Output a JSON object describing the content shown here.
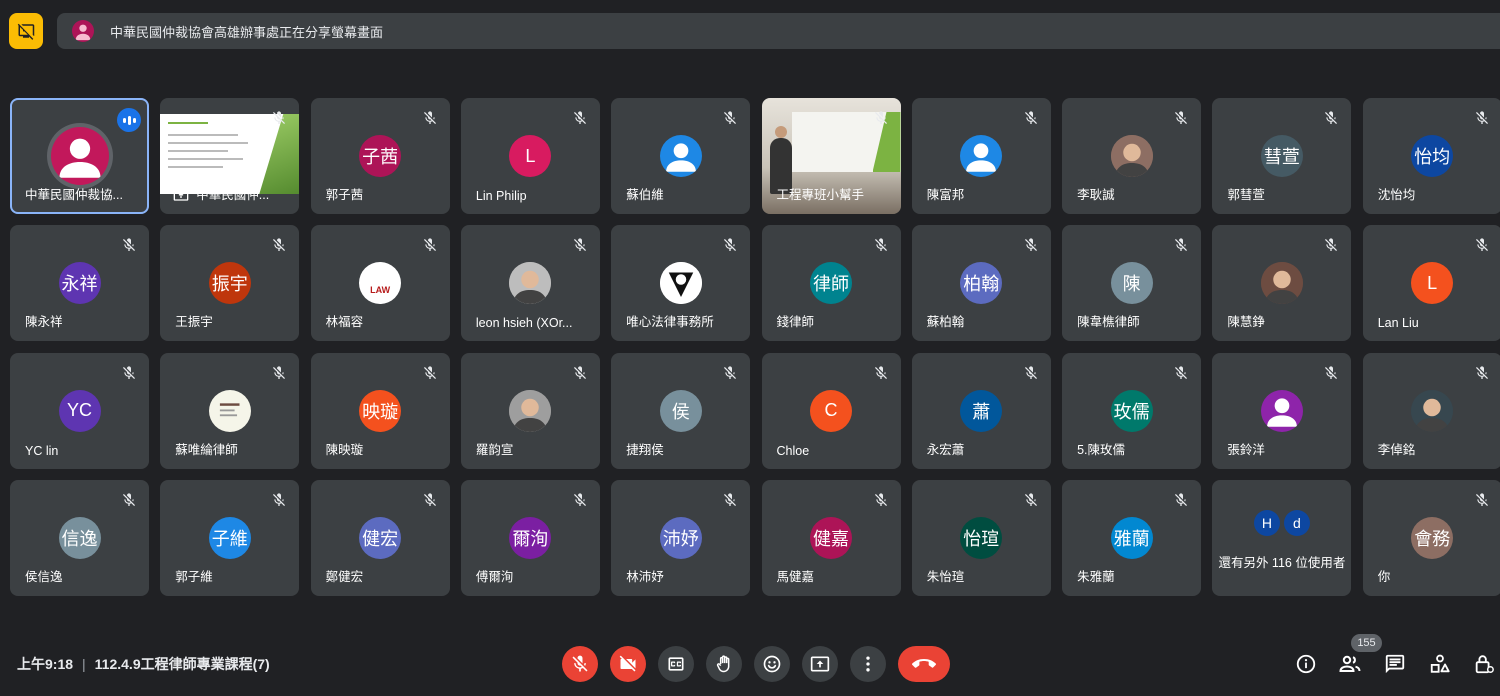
{
  "banner": {
    "text": "中華民國仲裁協會高雄辦事處正在分享螢幕畫面"
  },
  "tiles": [
    {
      "name": "中華民國仲裁協...",
      "initials": "",
      "color": "#c2185b",
      "type": "active-speaker"
    },
    {
      "name": "中華民國仲...",
      "initials": "",
      "color": "#ffffff",
      "type": "presentation"
    },
    {
      "name": "郭子茜",
      "initials": "子茜",
      "color": "#ad1457",
      "type": "avatar"
    },
    {
      "name": "Lin Philip",
      "initials": "L",
      "color": "#d81b60",
      "type": "avatar"
    },
    {
      "name": "蘇伯維",
      "initials": "",
      "color": "#1e88e5",
      "type": "person"
    },
    {
      "name": "工程專班小幫手",
      "initials": "",
      "color": "#999999",
      "type": "video"
    },
    {
      "name": "陳富邦",
      "initials": "",
      "color": "#1e88e5",
      "type": "person"
    },
    {
      "name": "李耿誠",
      "initials": "",
      "color": "#8d6e63",
      "type": "photo"
    },
    {
      "name": "郭彗萱",
      "initials": "彗萱",
      "color": "#455a64",
      "type": "avatar"
    },
    {
      "name": "沈怡均",
      "initials": "怡均",
      "color": "#0d47a1",
      "type": "avatar"
    },
    {
      "name": "陳永祥",
      "initials": "永祥",
      "color": "#5e35b1",
      "type": "avatar"
    },
    {
      "name": "王振宇",
      "initials": "振宇",
      "color": "#bf360c",
      "type": "avatar"
    },
    {
      "name": "林福容",
      "initials": "LAW",
      "color": "#ffffff",
      "type": "logo"
    },
    {
      "name": "leon hsieh (XOr...",
      "initials": "",
      "color": "#bdbdbd",
      "type": "photo"
    },
    {
      "name": "唯心法律事務所",
      "initials": "",
      "color": "#ffffff",
      "type": "logo-dark"
    },
    {
      "name": "錢律師",
      "initials": "律師",
      "color": "#00838f",
      "type": "avatar"
    },
    {
      "name": "蘇柏翰",
      "initials": "柏翰",
      "color": "#5c6bc0",
      "type": "avatar"
    },
    {
      "name": "陳韋樵律師",
      "initials": "陳",
      "color": "#78909c",
      "type": "avatar"
    },
    {
      "name": "陳慧錚",
      "initials": "",
      "color": "#6d4c41",
      "type": "photo"
    },
    {
      "name": "Lan Liu",
      "initials": "L",
      "color": "#f4511e",
      "type": "avatar"
    },
    {
      "name": "YC lin",
      "initials": "YC",
      "color": "#5e35b1",
      "type": "avatar"
    },
    {
      "name": "蘇唯綸律師",
      "initials": "",
      "color": "#f5f5e9",
      "type": "logo"
    },
    {
      "name": "陳映璇",
      "initials": "映璇",
      "color": "#f4511e",
      "type": "avatar"
    },
    {
      "name": "羅韵宣",
      "initials": "",
      "color": "#9e9e9e",
      "type": "photo"
    },
    {
      "name": "捷翔侯",
      "initials": "侯",
      "color": "#78909c",
      "type": "avatar"
    },
    {
      "name": "Chloe",
      "initials": "C",
      "color": "#f4511e",
      "type": "avatar"
    },
    {
      "name": "永宏蕭",
      "initials": "蕭",
      "color": "#01579b",
      "type": "avatar"
    },
    {
      "name": "5.陳玫儒",
      "initials": "玫儒",
      "color": "#00796b",
      "type": "avatar"
    },
    {
      "name": "張鈴洋",
      "initials": "",
      "color": "#8e24aa",
      "type": "person"
    },
    {
      "name": "李倬銘",
      "initials": "",
      "color": "#37474f",
      "type": "photo"
    },
    {
      "name": "侯信逸",
      "initials": "信逸",
      "color": "#78909c",
      "type": "avatar"
    },
    {
      "name": "郭子維",
      "initials": "子維",
      "color": "#1e88e5",
      "type": "avatar"
    },
    {
      "name": "鄭健宏",
      "initials": "健宏",
      "color": "#5c6bc0",
      "type": "avatar"
    },
    {
      "name": "傅爾洵",
      "initials": "爾洵",
      "color": "#7b1fa2",
      "type": "avatar"
    },
    {
      "name": "林沛妤",
      "initials": "沛妤",
      "color": "#5c6bc0",
      "type": "avatar"
    },
    {
      "name": "馬健嘉",
      "initials": "健嘉",
      "color": "#ad1457",
      "type": "avatar"
    },
    {
      "name": "朱怡瑄",
      "initials": "怡瑄",
      "color": "#004d40",
      "type": "avatar"
    },
    {
      "name": "朱雅蘭",
      "initials": "雅蘭",
      "color": "#0288d1",
      "type": "avatar"
    },
    {
      "name": "還有另外 116 位使用者",
      "initials": "",
      "color": "#3c4043",
      "type": "more",
      "more_initials": [
        "H",
        "d"
      ]
    },
    {
      "name": "你",
      "initials": "會務",
      "color": "#8d6e63",
      "type": "avatar"
    }
  ],
  "meeting": {
    "time": "上午9:18",
    "separator": "|",
    "title": "112.4.9工程律師專業課程(7)"
  },
  "controls": {
    "participant_count": "155"
  },
  "colors": {
    "background": "#202124",
    "tile": "#3c4043",
    "danger": "#ea4335",
    "accent": "#8ab4f8",
    "present_badge": "#fbbc04"
  },
  "icons": [
    "present-to-all-off-icon",
    "mic-off-icon",
    "videocam-off-icon",
    "closed-caption-icon",
    "raise-hand-icon",
    "emoji-icon",
    "present-screen-icon",
    "more-vert-icon",
    "call-end-icon",
    "info-icon",
    "people-icon",
    "chat-icon",
    "activities-icon",
    "host-controls-icon"
  ]
}
